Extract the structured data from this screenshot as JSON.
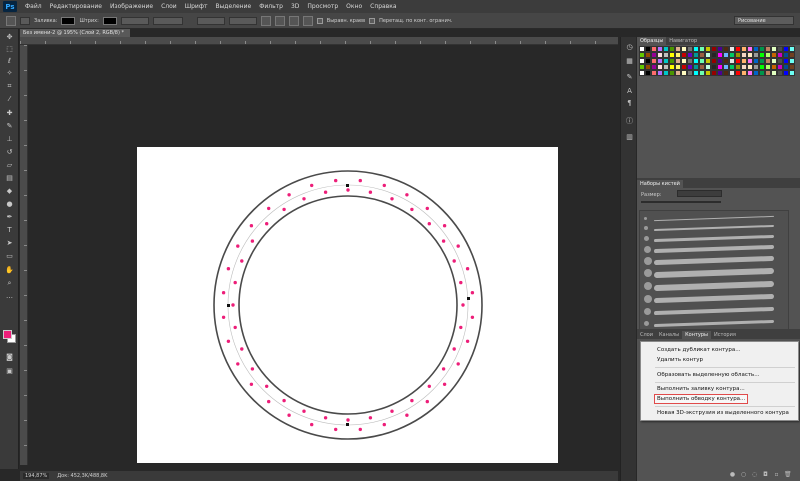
{
  "menubar": {
    "logo": "Ps",
    "items": [
      "Файл",
      "Редактирование",
      "Изображение",
      "Слои",
      "Шрифт",
      "Выделение",
      "Фильтр",
      "3D",
      "Просмотр",
      "Окно",
      "Справка"
    ]
  },
  "optbar": {
    "fill_label": "Заливка:",
    "stroke_label": "Штрих:",
    "align_edges_label": "Выравн. краев",
    "constrain_label": "Перетащ. по конт. огранич.",
    "workspace": "Рисование"
  },
  "document": {
    "tab_title": "Без имени-2 @ 195% (Слой 2, RGB/8) *",
    "zoom": "194,87%",
    "doc_size": "Док: 452,3K/488,8K"
  },
  "panels": {
    "swatches_tabs": [
      "Образцы",
      "Навигатор"
    ],
    "brushes_tab": "Наборы кистей",
    "brush_size_label": "Размер:",
    "paths_tabs": [
      "Слои",
      "Каналы",
      "Контуры",
      "История"
    ]
  },
  "context_menu": {
    "items": [
      "Создать дубликат контура...",
      "Удалить контур",
      "Образовать выделенную область...",
      "Выполнить заливку контура...",
      "Выполнить обводку контура...",
      "Новая 3D-экструзия из выделенного контура"
    ],
    "highlighted_index": 4
  },
  "colors": {
    "foreground": "#ed1e79",
    "background": "#ffffff",
    "ring_stroke": "#4a4a4a",
    "dot_color": "#ed1e79"
  },
  "icons": {
    "toolbar": [
      "move-icon",
      "marquee-icon",
      "lasso-icon",
      "magic-wand-icon",
      "crop-icon",
      "eyedropper-icon",
      "healing-brush-icon",
      "brush-icon",
      "clone-stamp-icon",
      "history-brush-icon",
      "eraser-icon",
      "gradient-icon",
      "blur-icon",
      "dodge-icon",
      "pen-icon",
      "type-icon",
      "path-selection-icon",
      "shape-icon",
      "hand-icon",
      "zoom-icon"
    ]
  }
}
